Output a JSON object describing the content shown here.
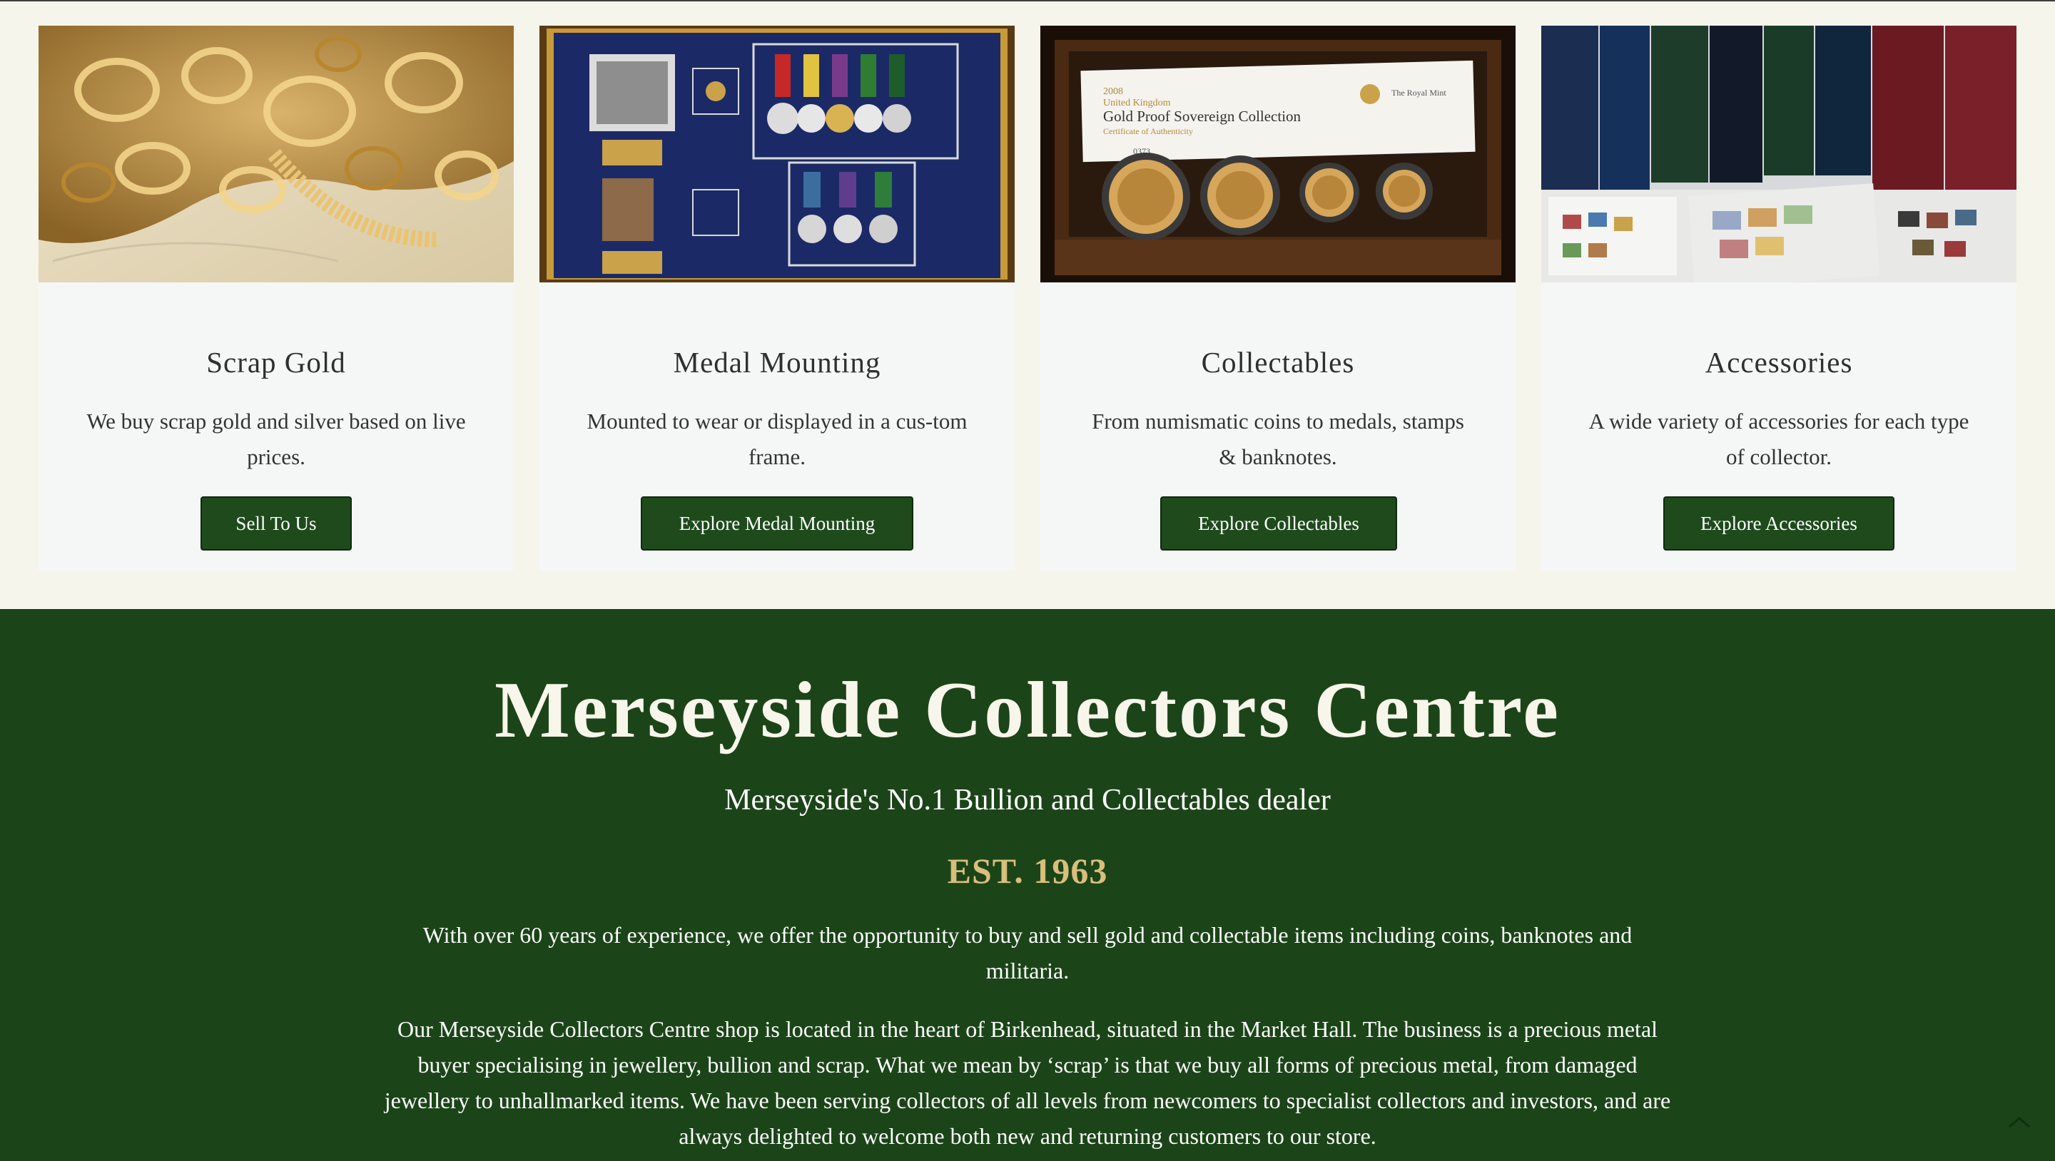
{
  "cards": [
    {
      "title": "Scrap Gold",
      "description": "We buy scrap gold and silver based on live prices.",
      "button": "Sell To Us",
      "image": "scrap-gold-jewellery-photo"
    },
    {
      "title": "Medal Mounting",
      "description": "Mounted to wear or displayed in a cus-tom frame.",
      "button": "Explore Medal Mounting",
      "image": "framed-medals-photo"
    },
    {
      "title": "Collectables",
      "description": "From numismatic coins to medals, stamps & banknotes.",
      "button": "Explore Collectables",
      "image": "gold-sovereign-collection-photo",
      "image_text": {
        "year": "2008",
        "country": "United Kingdom",
        "name": "Gold Proof Sovereign Collection",
        "cert": "Certificate of Authenticity",
        "mint": "The Royal Mint",
        "number": "0373"
      }
    },
    {
      "title": "Accessories",
      "description": "A wide variety of accessories for each type of collector.",
      "button": "Explore Accessories",
      "image": "stamp-albums-photo"
    }
  ],
  "about": {
    "heading": "Merseyside Collectors Centre",
    "subheading": "Merseyside's No.1 Bullion and Collectables dealer",
    "established": "EST. 1963",
    "paragraph1": "With over 60 years of experience, we offer the opportunity to buy and sell gold and collectable items including coins, banknotes and militaria.",
    "paragraph2": "Our Merseyside Collectors Centre shop is located in the heart of Birkenhead, situated in the Market Hall. The business is a precious metal buyer specialising in jewellery, bullion and scrap. What we mean by ‘scrap’ is that we buy all forms of precious metal, from damaged jewellery to unhallmarked items. We have been serving collectors of all levels from newcomers to specialist collectors and investors, and are always delighted to welcome both new and returning customers to our store."
  },
  "icons": {
    "scroll_top": "chevron-up-icon"
  },
  "colors": {
    "page_background": "#f6f5ec",
    "card_background": "#f5f7f7",
    "brand_green": "#1b4518",
    "button_green": "#1e4a1c",
    "gold_accent": "#d9be7c"
  }
}
